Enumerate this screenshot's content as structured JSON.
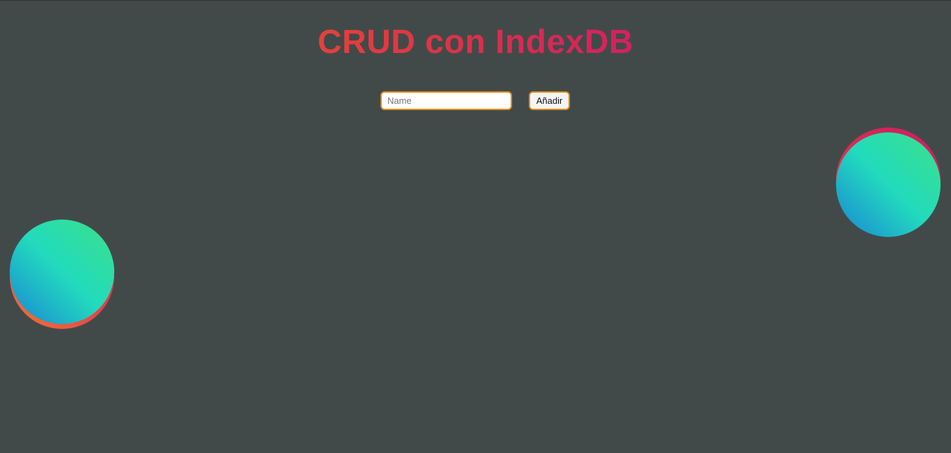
{
  "header": {
    "title": "CRUD con IndexDB"
  },
  "form": {
    "name_input": {
      "placeholder": "Name",
      "value": ""
    },
    "add_button_label": "Añadir"
  },
  "decorations": {
    "ball_face_gradient": [
      "#1a84d6",
      "#22dbbd",
      "#3ce08a"
    ],
    "ball_shadow_gradient": [
      "#f0762f",
      "#e5404b",
      "#d4215f"
    ]
  },
  "colors": {
    "background": "#424a49",
    "title_gradient": [
      "#e2433a",
      "#d4215f"
    ],
    "input_border": "#e48a1b"
  }
}
